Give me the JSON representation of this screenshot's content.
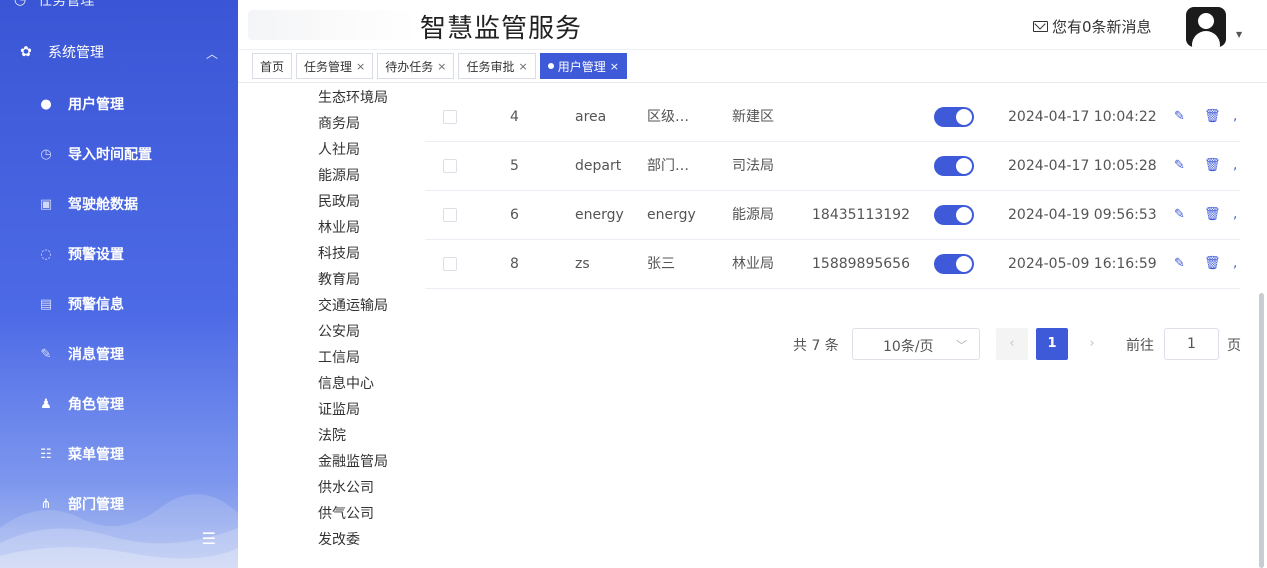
{
  "sidebar": {
    "top_ghost": "任务管理",
    "group": {
      "label": "系统管理",
      "icon": "gear-icon"
    },
    "items": [
      {
        "label": "用户管理",
        "icon": "user-icon"
      },
      {
        "label": "导入时间配置",
        "icon": "clock-icon"
      },
      {
        "label": "驾驶舱数据",
        "icon": "dashboard-icon"
      },
      {
        "label": "预警设置",
        "icon": "shield-icon"
      },
      {
        "label": "预警信息",
        "icon": "document-icon"
      },
      {
        "label": "消息管理",
        "icon": "edit-icon"
      },
      {
        "label": "角色管理",
        "icon": "role-icon"
      },
      {
        "label": "菜单管理",
        "icon": "menu-list-icon"
      },
      {
        "label": "部门管理",
        "icon": "org-tree-icon"
      }
    ]
  },
  "header": {
    "title": "智慧监管服务",
    "messages": "您有0条新消息"
  },
  "tabs": [
    {
      "label": "首页",
      "closable": false,
      "active": false
    },
    {
      "label": "任务管理",
      "closable": true,
      "active": false
    },
    {
      "label": "待办任务",
      "closable": true,
      "active": false
    },
    {
      "label": "任务审批",
      "closable": true,
      "active": false
    },
    {
      "label": "用户管理",
      "closable": true,
      "active": true
    }
  ],
  "departments": [
    "生态环境局",
    "商务局",
    "人社局",
    "能源局",
    "民政局",
    "林业局",
    "科技局",
    "教育局",
    "交通运输局",
    "公安局",
    "工信局",
    "信息中心",
    "证监局",
    "法院",
    "金融监管局",
    "供水公司",
    "供气公司",
    "发改委"
  ],
  "users": [
    {
      "id": "4",
      "username": "area",
      "nickname": "区级…",
      "dept": "新建区",
      "phone": "",
      "enabled": true,
      "created": "2024-04-17 10:04:22"
    },
    {
      "id": "5",
      "username": "depart",
      "nickname": "部门…",
      "dept": "司法局",
      "phone": "",
      "enabled": true,
      "created": "2024-04-17 10:05:28"
    },
    {
      "id": "6",
      "username": "energy",
      "nickname": "energy",
      "dept": "能源局",
      "phone": "18435113192",
      "enabled": true,
      "created": "2024-04-19 09:56:53"
    },
    {
      "id": "8",
      "username": "zs",
      "nickname": "张三",
      "dept": "林业局",
      "phone": "15889895656",
      "enabled": true,
      "created": "2024-05-09 16:16:59"
    }
  ],
  "pagination": {
    "total": "共 7 条",
    "page_size": "10条/页",
    "current": "1",
    "goto_label": "前往",
    "goto_value": "1",
    "page_suffix": "页"
  },
  "colors": {
    "primary": "#3f5ad8",
    "sidebar": "#4d6ae6"
  }
}
